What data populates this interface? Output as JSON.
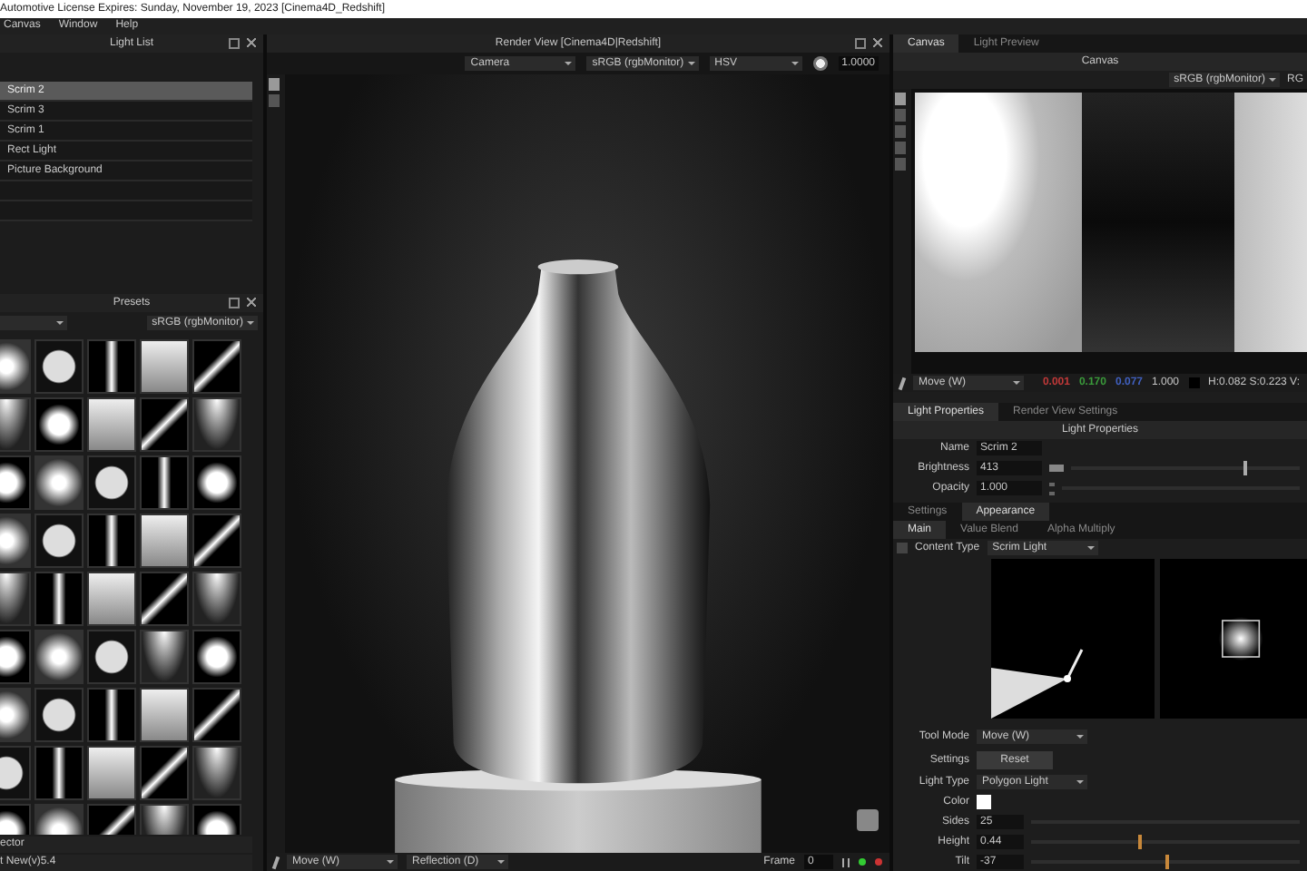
{
  "title_bar": {
    "title": "Automotive License Expires: Sunday, November 19, 2023  [Cinema4D_Redshift]"
  },
  "menu": [
    "Canvas",
    "Window",
    "Help"
  ],
  "light_list": {
    "title": "Light List",
    "items": [
      {
        "label": "Scrim 2",
        "selected": true
      },
      {
        "label": "Scrim 3",
        "selected": false
      },
      {
        "label": "Scrim 1",
        "selected": false
      },
      {
        "label": "Rect Light",
        "selected": false
      },
      {
        "label": "Picture Background",
        "selected": false
      }
    ]
  },
  "presets": {
    "title": "Presets",
    "color_space": "sRGB (rgbMonitor)",
    "footer": [
      "ector",
      "t New(v)5.4"
    ]
  },
  "render_view": {
    "title": "Render View [Cinema4D|Redshift]",
    "camera": "Camera",
    "color_space": "sRGB (rgbMonitor)",
    "mode": "HSV",
    "exposure": "1.0000",
    "tool": "Move (W)",
    "pass": "Reflection (D)",
    "frame_label": "Frame",
    "frame": "0"
  },
  "canvas_panel": {
    "tabs": [
      {
        "label": "Canvas",
        "selected": true
      },
      {
        "label": "Light Preview",
        "selected": false
      }
    ],
    "title": "Canvas",
    "color_space": "sRGB (rgbMonitor)",
    "channel": "RG",
    "tool": "Move (W)",
    "readout": [
      {
        "text": "0.001",
        "color": "#c03838"
      },
      {
        "text": "0.170",
        "color": "#3a9a3a"
      },
      {
        "text": "0.077",
        "color": "#4060c0"
      }
    ],
    "alpha": "1.000",
    "hsv": "H:0.082 S:0.223 V:"
  },
  "properties": {
    "tabs": [
      {
        "label": "Light Properties",
        "selected": true
      },
      {
        "label": "Render View Settings",
        "selected": false
      }
    ],
    "title": "Light Properties",
    "fields": [
      {
        "label": "Name",
        "value": "Scrim 2",
        "kind": "text"
      },
      {
        "label": "Brightness",
        "value": "413",
        "kind": "slider",
        "level": 0.75
      },
      {
        "label": "Opacity",
        "value": "1.000",
        "kind": "spin"
      }
    ],
    "sub_tabs": [
      {
        "label": "Settings",
        "selected": false
      },
      {
        "label": "Appearance",
        "selected": true
      }
    ],
    "mode_tabs": [
      {
        "label": "Main",
        "selected": true
      },
      {
        "label": "Value Blend",
        "selected": false
      },
      {
        "label": "Alpha Multiply",
        "selected": false
      }
    ],
    "content_type": {
      "label": "Content Type",
      "value": "Scrim Light",
      "checked": false
    },
    "tool_mode": {
      "label": "Tool Mode",
      "value": "Move (W)"
    },
    "settings": {
      "label": "Settings",
      "button": "Reset"
    },
    "light_type": {
      "label": "Light Type",
      "value": "Polygon Light"
    },
    "params": [
      {
        "label": "Color",
        "kind": "color"
      },
      {
        "label": "Sides",
        "value": "25",
        "kind": "slider"
      },
      {
        "label": "Height",
        "value": "0.44",
        "kind": "slider",
        "level": 0.4
      },
      {
        "label": "Tilt",
        "value": "-37",
        "kind": "slider",
        "level": 0.5
      }
    ]
  }
}
